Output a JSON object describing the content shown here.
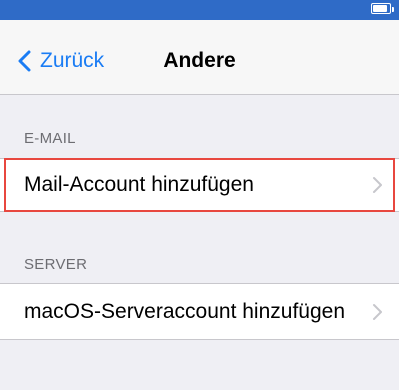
{
  "nav": {
    "back_label": "Zurück",
    "title": "Andere"
  },
  "sections": {
    "email": {
      "header": "E-MAIL",
      "row_label": "Mail-Account hinzufügen"
    },
    "server": {
      "header": "SERVER",
      "row_label": "macOS-Serveraccount hinzufügen"
    }
  },
  "colors": {
    "status_bar": "#2f6bc7",
    "accent": "#1a7cf4",
    "highlight": "#e8473f",
    "background": "#efeff4"
  },
  "icons": {
    "back": "chevron-left-icon",
    "row": "chevron-right-icon",
    "battery": "battery-icon"
  }
}
